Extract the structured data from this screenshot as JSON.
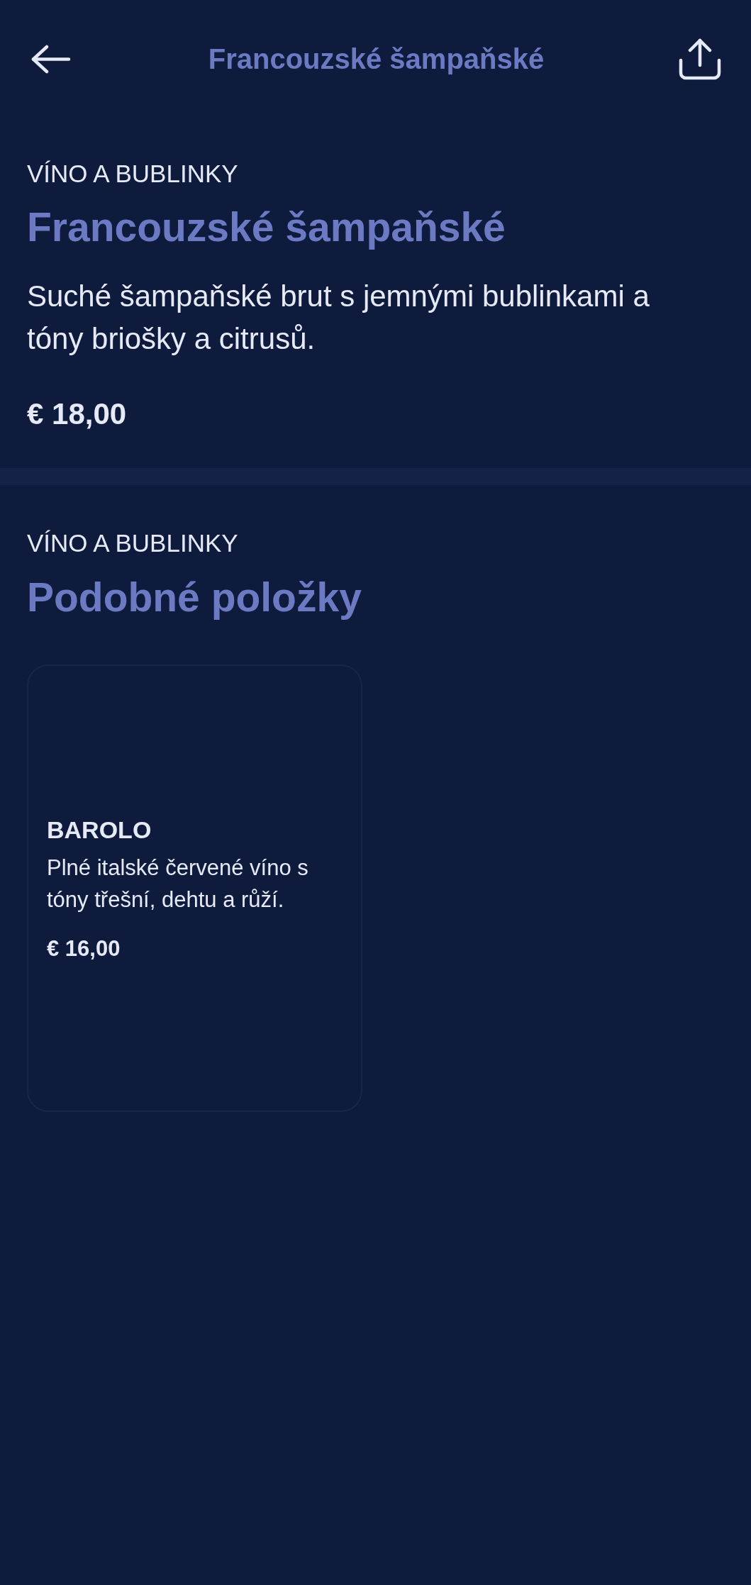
{
  "header": {
    "title": "Francouzské šampaňské"
  },
  "product": {
    "category": "VÍNO A BUBLINKY",
    "name": "Francouzské šampaňské",
    "description": "Suché šampaňské brut s jemnými bublinkami a tóny briošky a citrusů.",
    "price": "€ 18,00"
  },
  "similar": {
    "category": "VÍNO A BUBLINKY",
    "title": "Podobné položky",
    "items": [
      {
        "name": "BAROLO",
        "description": "Plné italské červené víno s tóny třešní, dehtu a růží.",
        "price": "€ 16,00"
      }
    ]
  }
}
